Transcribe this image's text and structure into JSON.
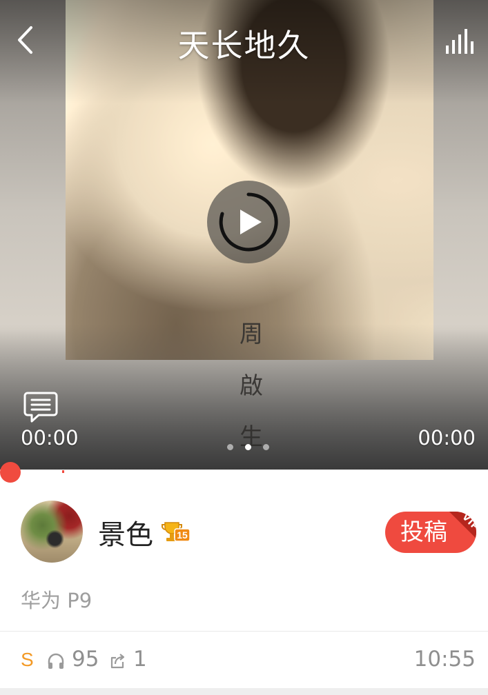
{
  "header": {
    "title": "天长地久"
  },
  "album": {
    "characters": [
      "周",
      "啟",
      "生"
    ]
  },
  "player": {
    "current_time": "00:00",
    "total_time": "00:00",
    "progress": 0,
    "pager": {
      "count": 3,
      "active_index": 1
    },
    "colors": {
      "accent": "#f04b3f"
    }
  },
  "user": {
    "name": "景色",
    "level": "15",
    "device": "华为 P9"
  },
  "submit": {
    "label": "投稿",
    "badge": "VIP"
  },
  "stats": {
    "badge": "S",
    "listens": "95",
    "shares": "1",
    "duration": "10:55",
    "icons": [
      "headphones-icon",
      "share-icon"
    ]
  }
}
